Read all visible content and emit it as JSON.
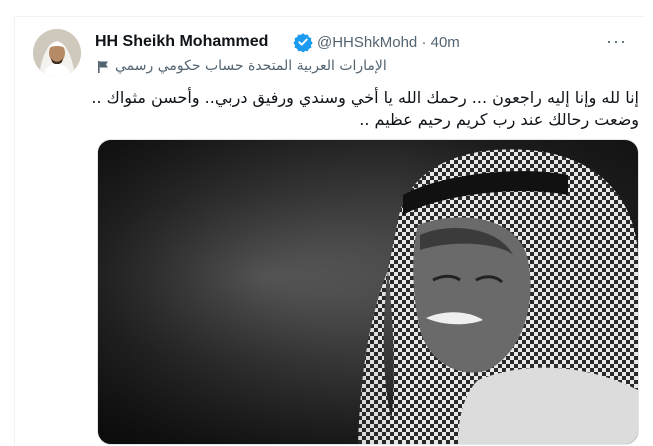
{
  "tweet": {
    "author_name": "HH Sheikh Mohammed",
    "handle": "@HHShkMohd",
    "separator": "·",
    "time": "40m",
    "account_label": "الإمارات العربية المتحدة حساب حكومي رسمي",
    "text_lines": [
      "إنا لله وإنا إليه راجعون ... رحمك الله يا أخي وسندي ورفيق دربي.. وأحسن مثواك ..",
      "وضعت رحالك عند رب كريم رحيم عظيم .."
    ],
    "more_label": "···"
  },
  "colors": {
    "text_primary": "#0f1419",
    "text_secondary": "#536471",
    "verified_blue": "#1d9bf0"
  },
  "icons": {
    "verified": "verified-badge-icon",
    "flag": "government-flag-icon",
    "more": "more-dots-icon"
  }
}
